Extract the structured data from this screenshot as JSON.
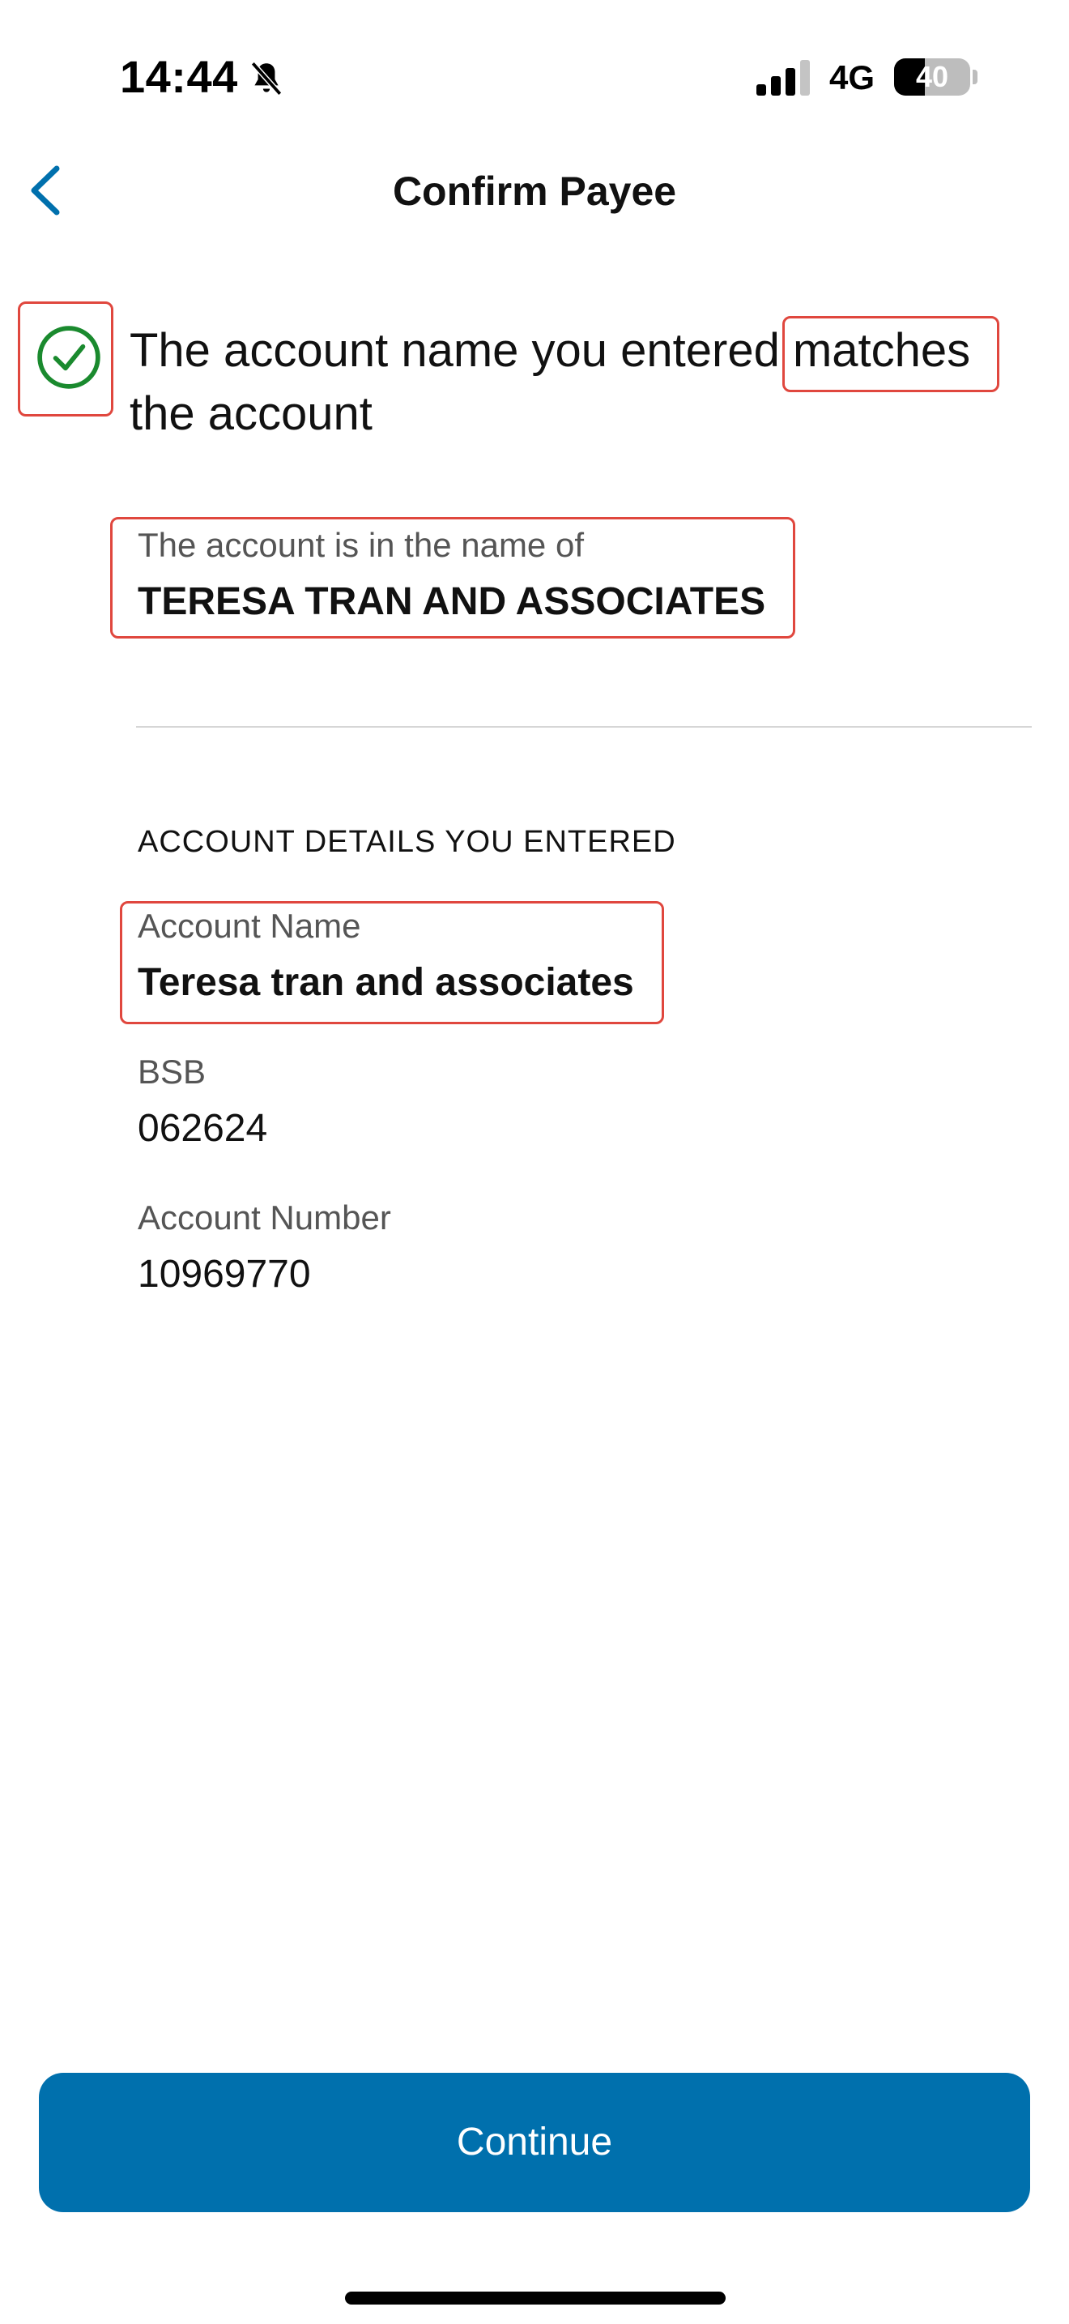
{
  "status_bar": {
    "time": "14:44",
    "network": "4G",
    "battery_level": "40",
    "battery_fraction": 0.4,
    "icons": [
      "bell-slash-icon",
      "signal-icon"
    ]
  },
  "nav": {
    "title": "Confirm Payee",
    "back_icon": "chevron-left-icon"
  },
  "result": {
    "icon": "check-circle-icon",
    "text": "The account name you entered matches the account"
  },
  "account_holder": {
    "label": "The account is in the name of",
    "name": "TERESA TRAN AND ASSOCIATES"
  },
  "entered_details": {
    "heading": "ACCOUNT DETAILS YOU ENTERED",
    "fields": [
      {
        "label": "Account Name",
        "value": "Teresa tran and associates"
      },
      {
        "label": "BSB",
        "value": "062624"
      },
      {
        "label": "Account Number",
        "value": "10969770"
      }
    ]
  },
  "actions": {
    "continue_label": "Continue"
  },
  "colors": {
    "accent": "#0070ad",
    "success": "#1a8a2e",
    "highlight": "#e0473e"
  }
}
